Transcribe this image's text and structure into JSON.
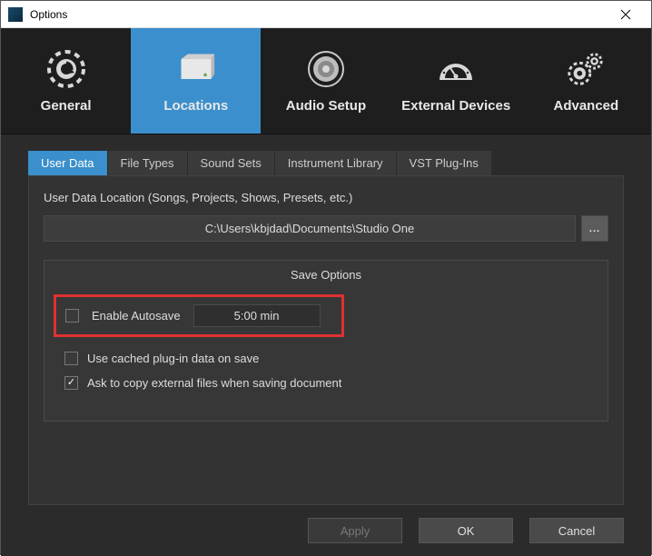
{
  "window": {
    "title": "Options"
  },
  "primaryTabs": {
    "general": "General",
    "locations": "Locations",
    "audio": "Audio Setup",
    "external": "External Devices",
    "advanced": "Advanced",
    "active": "locations"
  },
  "subTabs": {
    "userData": "User Data",
    "fileTypes": "File Types",
    "soundSets": "Sound Sets",
    "instrumentLibrary": "Instrument Library",
    "vstPlugins": "VST Plug-Ins",
    "active": "userData"
  },
  "userData": {
    "heading": "User Data Location (Songs, Projects, Shows, Presets, etc.)",
    "path": "C:\\Users\\kbjdad\\Documents\\Studio One",
    "browseLabel": "..."
  },
  "saveOptions": {
    "heading": "Save Options",
    "enableAutosave": {
      "label": "Enable Autosave",
      "checked": false,
      "interval": "5:00 min"
    },
    "useCachedPlugin": {
      "label": "Use cached plug-in data on save",
      "checked": false
    },
    "askCopyExternal": {
      "label": "Ask to copy external files when saving document",
      "checked": true
    }
  },
  "footer": {
    "apply": "Apply",
    "ok": "OK",
    "cancel": "Cancel"
  }
}
